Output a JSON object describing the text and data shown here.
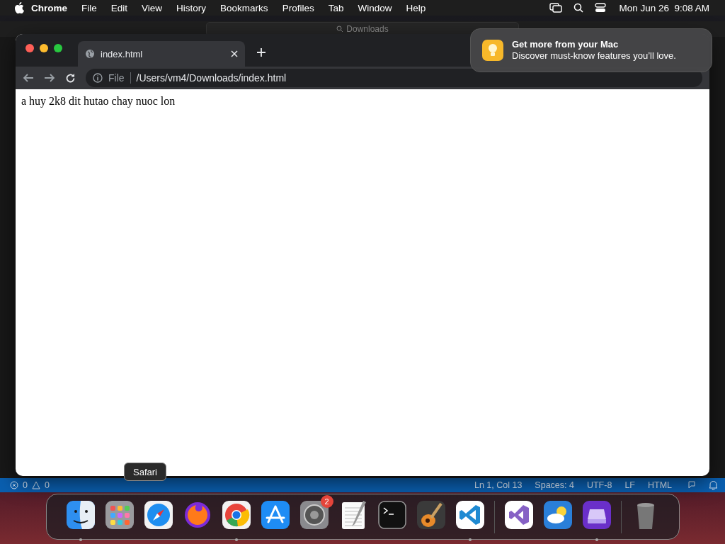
{
  "menubar": {
    "app": "Chrome",
    "items": [
      "File",
      "Edit",
      "View",
      "History",
      "Bookmarks",
      "Profiles",
      "Tab",
      "Window",
      "Help"
    ],
    "clock": "Mon Jun 26  9:08 AM"
  },
  "editor": {
    "search": "Downloads",
    "status": {
      "errors": "0",
      "warnings": "0",
      "items": [
        "Ln 1, Col 13",
        "Spaces: 4",
        "UTF-8",
        "LF",
        "HTML"
      ]
    }
  },
  "browser": {
    "tab": {
      "title": "index.html"
    },
    "scheme": "File",
    "url": "/Users/vm4/Downloads/index.html",
    "page_text": "a huy 2k8 dit hutao chay nuoc lon"
  },
  "notification": {
    "title": "Get more from your Mac",
    "body": "Discover must-know features you’ll love."
  },
  "dock": {
    "tooltip": "Safari",
    "items": [
      {
        "kind": "finder",
        "running": true
      },
      {
        "kind": "launchpad",
        "running": false
      },
      {
        "kind": "safari",
        "running": false
      },
      {
        "kind": "firefox",
        "running": false
      },
      {
        "kind": "chrome",
        "running": true
      },
      {
        "kind": "appstore",
        "running": false
      },
      {
        "kind": "settings",
        "running": false,
        "badge": "2"
      },
      {
        "kind": "textedit",
        "running": false
      },
      {
        "kind": "terminal",
        "running": false
      },
      {
        "kind": "garageband",
        "running": false
      },
      {
        "kind": "vscode",
        "running": true
      },
      {
        "kind": "separator"
      },
      {
        "kind": "visualstudio",
        "running": false
      },
      {
        "kind": "weather",
        "running": false
      },
      {
        "kind": "storage",
        "running": true
      },
      {
        "kind": "separator"
      },
      {
        "kind": "trash",
        "running": false
      }
    ]
  }
}
